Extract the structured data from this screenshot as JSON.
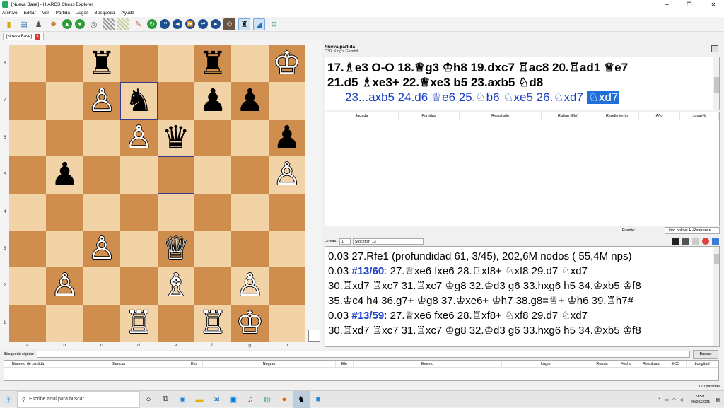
{
  "window": {
    "title": "[Nueva Base] - HIARCS Chess Explorer",
    "minimize": "─",
    "maximize": "❐",
    "close": "✕"
  },
  "menu": [
    "Archivo",
    "Editar",
    "Ver",
    "Partida",
    "Jugar",
    "Búsqueda",
    "Ayuda"
  ],
  "toolbar_icons": [
    "new-icon",
    "open-icon",
    "user-icon",
    "player-icon",
    "back-icon",
    "forward-icon",
    "settings-icon",
    "board-icon",
    "board2-icon",
    "edit-icon",
    "refresh-icon",
    "first-icon",
    "prev-icon",
    "play-icon",
    "next-icon",
    "last-icon",
    "player-photo-icon",
    "black-piece-icon",
    "flip-icon",
    "gear-icon"
  ],
  "tab": {
    "label": "[Nueva Base]",
    "close": "✕"
  },
  "board": {
    "ranks": [
      "8",
      "7",
      "6",
      "5",
      "4",
      "3",
      "2",
      "1"
    ],
    "files": [
      "a",
      "b",
      "c",
      "d",
      "e",
      "f",
      "g",
      "h"
    ],
    "rows": [
      [
        "",
        "",
        "♜",
        "",
        "",
        "♜",
        "",
        "♔"
      ],
      [
        "",
        "",
        "♙",
        "♞",
        "",
        "♟",
        "♟",
        ""
      ],
      [
        "",
        "",
        "",
        "♙",
        "♛",
        "",
        "",
        "♟"
      ],
      [
        "",
        "♟",
        "",
        "",
        "",
        "",
        "",
        "♙"
      ],
      [
        "",
        "",
        "",
        "",
        "",
        "",
        "",
        ""
      ],
      [
        "",
        "",
        "♙",
        "",
        "♕",
        "",
        "",
        ""
      ],
      [
        "",
        "♙",
        "",
        "",
        "♗",
        "",
        "♙",
        ""
      ],
      [
        "",
        "",
        "",
        "♖",
        "",
        "♖",
        "♔",
        ""
      ]
    ],
    "black_pieces_rows": [
      [
        0,
        0,
        1,
        0,
        0,
        1,
        0,
        0
      ],
      [
        0,
        0,
        0,
        1,
        0,
        1,
        1,
        0
      ],
      [
        0,
        0,
        0,
        0,
        1,
        0,
        0,
        1
      ],
      [
        0,
        1,
        0,
        0,
        0,
        0,
        0,
        0
      ],
      [
        0,
        0,
        0,
        0,
        0,
        0,
        0,
        0
      ],
      [
        0,
        0,
        0,
        0,
        0,
        0,
        0,
        0
      ],
      [
        0,
        0,
        0,
        0,
        0,
        0,
        0,
        0
      ],
      [
        0,
        0,
        0,
        0,
        0,
        0,
        0,
        0
      ]
    ],
    "highlight": [
      "d7",
      "e5"
    ]
  },
  "game": {
    "title": "Nueva partida",
    "eco": "C30: King's Gambit",
    "main_line_1": "17.♗e3 O-O 18.♕g3 ♔h8 19.dxc7 ♖ac8 20.♖ad1 ♕e7",
    "main_line_2": "21.d5 ♗xe3+ 22.♕xe3 b5 23.axb5 ♘d8",
    "variation": "23...axb5 24.d6 ♕e6 25.♘b6 ♘xe5 26.♘xd7",
    "current_move": "♘xd7"
  },
  "reference": {
    "columns": [
      "Jugada",
      "Partidas",
      "Resultado",
      "Rating (Elo)",
      "Rendimiento",
      "Año",
      "Jugar%"
    ],
    "source_label": "Fuente:",
    "source_value": "Libro online: H-Reference"
  },
  "engine": {
    "lines_label": "Lineas:",
    "lines_value": "1",
    "engine_name": "Stockfish 13",
    "analysis": [
      {
        "prefix": "0.03 27.Rfe1 (profundidad 61, 3/45), 202,6M nodos ( 55,4M nps)",
        "num": "",
        "text": ""
      },
      {
        "prefix": "0.03 ",
        "num": "#13/60",
        "text": ": 27.♕xe6 fxe6 28.♖xf8+ ♘xf8 29.d7 ♘xd7"
      },
      {
        "prefix": "30.♖xd7 ♖xc7 31.♖xc7 ♔g8 32.♔d3 g6 33.hxg6 h5 34.♔xb5 ♔f8",
        "num": "",
        "text": ""
      },
      {
        "prefix": "35.♔c4 h4 36.g7+ ♔g8 37.♔xe6+ ♔h7 38.g8=♕+ ♔h6 39.♖h7#",
        "num": "",
        "text": ""
      },
      {
        "prefix": "0.03 ",
        "num": "#13/59",
        "text": ": 27.♕xe6 fxe6 28.♖xf8+ ♘xf8 29.d7 ♘xd7"
      },
      {
        "prefix": "30.♖xd7 ♖xc7 31.♖xc7 ♔g8 32.♔d3 g6 33.hxg6 h5 34.♔xb5 ♔f8",
        "num": "",
        "text": ""
      }
    ]
  },
  "quick_search": {
    "label": "Búsqueda rápida:",
    "button": "Buscar",
    "value": ""
  },
  "results": {
    "columns": [
      "Número de partida",
      "Blancas",
      "Elo",
      "Negras",
      "Elo",
      "Evento",
      "Lugar",
      "Ronda",
      "Fecha",
      "Resultado",
      "ECO",
      "Longitud"
    ],
    "status": "0/0 partidas"
  },
  "taskbar": {
    "search_placeholder": "Escribe aquí para buscar",
    "time": "9:59",
    "date": "20/02/2021"
  }
}
